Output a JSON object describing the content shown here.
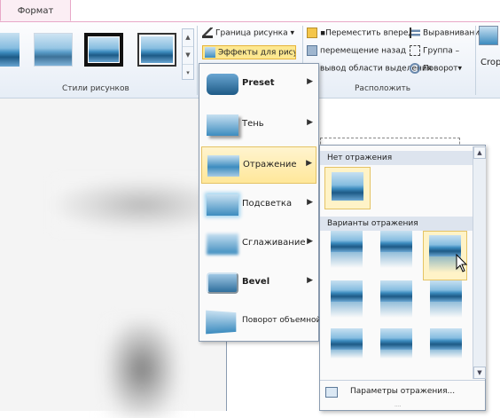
{
  "tabs": {
    "format": "Формат"
  },
  "ribbon": {
    "picture_styles_label": "Стили рисунков",
    "border_label": "Граница рисунка",
    "effects_label": "Эффекты для рисунка",
    "bring_forward": "Переместить вперед",
    "send_backward": "перемещение назад",
    "selection_pane": "вывод области выделения",
    "align": "Выравнивание",
    "group": "Группа",
    "rotate": "Поворот",
    "arrange_label": "Расположить",
    "crop": "Crop"
  },
  "effects_menu": {
    "items": [
      {
        "label": "Preset"
      },
      {
        "label": "Тень"
      },
      {
        "label": "Отражение"
      },
      {
        "label": "Подсветка"
      },
      {
        "label": "Сглаживание"
      },
      {
        "label": "Bevel"
      },
      {
        "label": "Поворот объемной фигуры"
      }
    ]
  },
  "reflection_panel": {
    "no_reflection_header": "Нет отражения",
    "variants_header": "Варианты отражения",
    "options_link": "Параметры отражения..."
  },
  "colors": {
    "highlight": "#ffe79a",
    "accent_border": "#e5c365",
    "ribbon_text": "#1e395b"
  }
}
